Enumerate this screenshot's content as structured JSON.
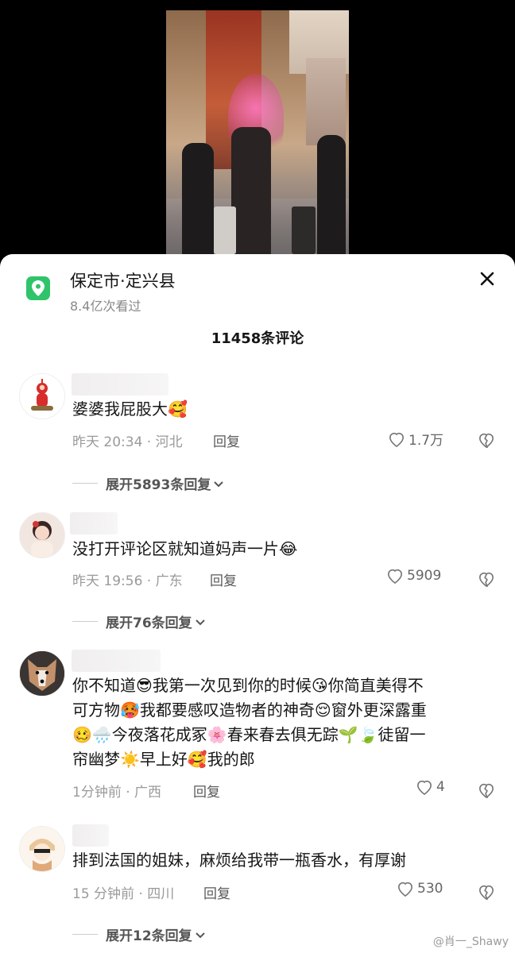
{
  "location": {
    "title": "保定市·定兴县",
    "views": "8.4亿次看过",
    "pin_color": "#2fc46a"
  },
  "comments_title": "11458条评论",
  "comments": [
    {
      "text": "婆婆我屁股大🥰",
      "time_location": "昨天 20:34 · 河北",
      "reply_label": "回复",
      "likes": "1.7万",
      "expand_label": "展开5893条回复"
    },
    {
      "text": "没打开评论区就知道妈声一片😂",
      "time_location": "昨天 19:56 · 广东",
      "reply_label": "回复",
      "likes": "5909",
      "expand_label": "展开76条回复"
    },
    {
      "text_lines": [
        "你不知道😎我第一次见到你的时候😘你简直美得不",
        "可方物🥵我都要感叹造物者的神奇😌窗外更深露重",
        "🥴🌧️今夜落花成冢🌸春来春去俱无踪🌱🍃徒留一",
        "帘幽梦☀️早上好🥰我的郎"
      ],
      "time_location": "1分钟前 · 广西",
      "reply_label": "回复",
      "likes": "4"
    },
    {
      "text": "排到法国的姐妹，麻烦给我带一瓶香水，有厚谢",
      "time_location": "15 分钟前 · 四川",
      "reply_label": "回复",
      "likes": "530",
      "expand_label": "展开12条回复"
    }
  ],
  "watermark": "@肖一_Shawy"
}
